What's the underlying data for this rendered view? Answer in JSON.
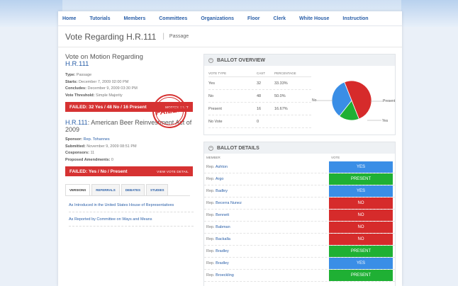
{
  "nav": [
    "Home",
    "Tutorials",
    "Members",
    "Committees",
    "Organizations",
    "Floor",
    "Clerk",
    "White House",
    "Instruction"
  ],
  "title": "Vote Regarding H.R.111",
  "subtitle": "Passage",
  "motion": {
    "heading_prefix": "Vote on Motion Regarding",
    "heading_link": "H.R.111",
    "type_label": "Type:",
    "type_value": "Passage",
    "starts_label": "Starts:",
    "starts_value": "December 7, 2009 02:00 PM",
    "concludes_label": "Concludes:",
    "concludes_value": "December 9, 2009 03:30 PM",
    "threshold_label": "Vote Threshold:",
    "threshold_value": "Simple Majority",
    "result": "FAILED: 32 Yes / 48 No / 16 Present",
    "result_link": "MOTION TEXT"
  },
  "bill": {
    "heading_link": "H.R.111",
    "heading_rest": ": American Beer Reinvestment Act of 2009",
    "sponsor_label": "Sponsor:",
    "sponsor_value": "Rep. Tohannes",
    "submitted_label": "Submitted:",
    "submitted_value": "November 9, 2009 08:51 PM",
    "cosponsors_label": "Cosponsors:",
    "cosponsors_value": "11",
    "amendments_label": "Proposed Amendments:",
    "amendments_value": "0",
    "result": "FAILED: Yes / No / Present",
    "result_link": "VIEW VOTE DETAIL",
    "stamp": "FAILED"
  },
  "tabs": [
    "VERSIONS",
    "REFERRALS",
    "DEBATES",
    "STUDIES"
  ],
  "versions": [
    "As Introduced in the United States House of Representatives",
    "As Reported by Committee on Ways and Means"
  ],
  "overview": {
    "title": "BALLOT OVERVIEW",
    "headers": [
      "VOTE TYPE",
      "CAST",
      "PERCENTAGE"
    ],
    "rows": [
      {
        "type": "Yes",
        "cast": "32",
        "pct": "33.33%"
      },
      {
        "type": "No",
        "cast": "48",
        "pct": "50.0%"
      },
      {
        "type": "Present",
        "cast": "16",
        "pct": "16.67%"
      },
      {
        "type": "No Vote",
        "cast": "0",
        "pct": ""
      }
    ],
    "pie_labels": {
      "no": "No",
      "present": "Present",
      "yes": "Yes"
    }
  },
  "details": {
    "title": "BALLOT DETAILS",
    "headers": [
      "MEMBER",
      "VOTE"
    ],
    "rows": [
      {
        "prefix": "Rep.",
        "name": "Ashton",
        "vote": "YES"
      },
      {
        "prefix": "Rep.",
        "name": "Argo",
        "vote": "PRESENT"
      },
      {
        "prefix": "Rep.",
        "name": "Badley",
        "vote": "YES"
      },
      {
        "prefix": "Rep.",
        "name": "Becerra Nunez",
        "vote": "NO"
      },
      {
        "prefix": "Rep.",
        "name": "Bennett",
        "vote": "NO"
      },
      {
        "prefix": "Rep.",
        "name": "Babman",
        "vote": "NO"
      },
      {
        "prefix": "Rep.",
        "name": "Backalla",
        "vote": "NO"
      },
      {
        "prefix": "Rep.",
        "name": "Bradley",
        "vote": "PRESENT"
      },
      {
        "prefix": "Rep.",
        "name": "Bradley",
        "vote": "YES"
      },
      {
        "prefix": "Rep.",
        "name": "Broeckling",
        "vote": "PRESENT"
      }
    ]
  },
  "colors": {
    "yes": "#3a8ee6",
    "no": "#d62b2b",
    "present": "#1fb034",
    "accent": "#2a5fa8",
    "failed": "#d63232"
  }
}
